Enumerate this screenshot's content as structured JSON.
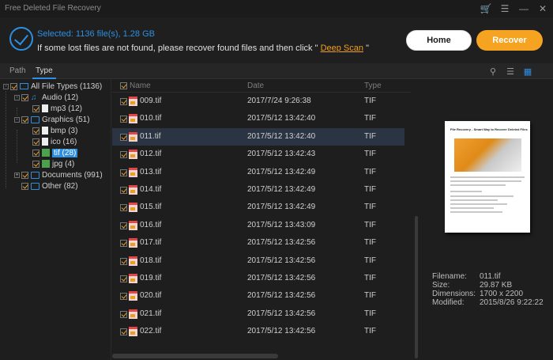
{
  "app": {
    "title": "Free Deleted File Recovery"
  },
  "header": {
    "selected": "Selected: 1136 file(s), 1.28 GB",
    "hint_prefix": "If some lost files are not found, please recover found files and then click \"",
    "deep_scan": "Deep Scan",
    "hint_suffix": "\"",
    "home": "Home",
    "recover": "Recover"
  },
  "tabs": {
    "path": "Path",
    "type": "Type"
  },
  "tree": {
    "all": "All File Types (1136)",
    "audio": "Audio (12)",
    "mp3": "mp3 (12)",
    "graphics": "Graphics (51)",
    "bmp": "bmp (3)",
    "ico": "ico (16)",
    "tif": "tif (28)",
    "jpg": "jpg (4)",
    "documents": "Documents (991)",
    "other": "Other (82)"
  },
  "list": {
    "headers": {
      "name": "Name",
      "date": "Date",
      "type": "Type"
    },
    "rows": [
      {
        "name": "009.tif",
        "date": "2017/7/24 9:26:38",
        "type": "TIF"
      },
      {
        "name": "010.tif",
        "date": "2017/5/12 13:42:40",
        "type": "TIF"
      },
      {
        "name": "011.tif",
        "date": "2017/5/12 13:42:40",
        "type": "TIF"
      },
      {
        "name": "012.tif",
        "date": "2017/5/12 13:42:43",
        "type": "TIF"
      },
      {
        "name": "013.tif",
        "date": "2017/5/12 13:42:49",
        "type": "TIF"
      },
      {
        "name": "014.tif",
        "date": "2017/5/12 13:42:49",
        "type": "TIF"
      },
      {
        "name": "015.tif",
        "date": "2017/5/12 13:42:49",
        "type": "TIF"
      },
      {
        "name": "016.tif",
        "date": "2017/5/12 13:43:09",
        "type": "TIF"
      },
      {
        "name": "017.tif",
        "date": "2017/5/12 13:42:56",
        "type": "TIF"
      },
      {
        "name": "018.tif",
        "date": "2017/5/12 13:42:56",
        "type": "TIF"
      },
      {
        "name": "019.tif",
        "date": "2017/5/12 13:42:56",
        "type": "TIF"
      },
      {
        "name": "020.tif",
        "date": "2017/5/12 13:42:56",
        "type": "TIF"
      },
      {
        "name": "021.tif",
        "date": "2017/5/12 13:42:56",
        "type": "TIF"
      },
      {
        "name": "022.tif",
        "date": "2017/5/12 13:42:56",
        "type": "TIF"
      }
    ]
  },
  "preview": {
    "doc_title": "File Recovery - Smart Way to Recover Deleted Files",
    "filename_label": "Filename:",
    "filename": "011.tif",
    "size_label": "Size:",
    "size": "29.87 KB",
    "dimensions_label": "Dimensions:",
    "dimensions": "1700 x 2200",
    "modified_label": "Modified:",
    "modified": "2015/8/26 9:22:22"
  },
  "icons": {
    "cart": "cart-icon",
    "menu": "menu-icon",
    "minimize": "minimize-icon",
    "close": "close-icon",
    "search": "search-icon",
    "list_view": "list-view-icon",
    "thumb_view": "thumbnail-view-icon"
  },
  "colors": {
    "accent": "#2e8fe0",
    "recover": "#f6a321",
    "check": "#f0a020",
    "selected_row": "#2b3442"
  }
}
